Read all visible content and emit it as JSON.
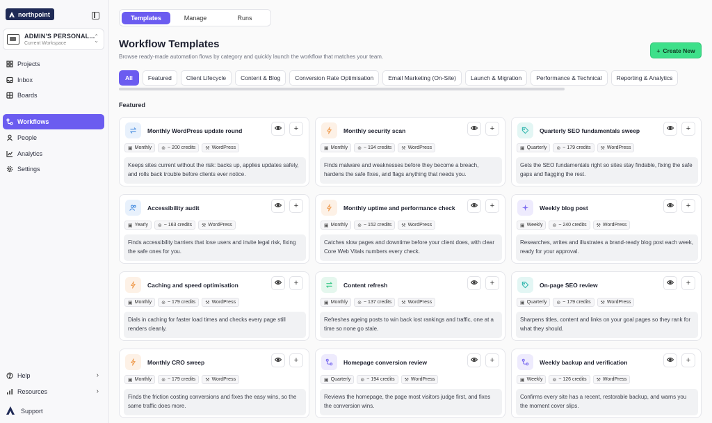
{
  "brand": {
    "logo_text": "northpoint"
  },
  "workspace": {
    "name": "ADMIN'S PERSONAL...",
    "subtitle": "Current Workspace"
  },
  "nav": {
    "projects": "Projects",
    "inbox": "Inbox",
    "boards": "Boards",
    "workflows": "Workflows",
    "people": "People",
    "analytics": "Analytics",
    "settings": "Settings",
    "help": "Help",
    "resources": "Resources",
    "support": "Support"
  },
  "tabs": {
    "templates": "Templates",
    "manage": "Manage",
    "runs": "Runs"
  },
  "header": {
    "title": "Workflow Templates",
    "subtitle": "Browse ready-made automation flows by category and quickly launch the workflow that matches your team.",
    "create_label": "Create New"
  },
  "filters": [
    "All",
    "Featured",
    "Client Lifecycle",
    "Content & Blog",
    "Conversion Rate Optimisation",
    "Email Marketing (On-Site)",
    "Launch & Migration",
    "Performance & Technical",
    "Reporting & Analytics"
  ],
  "section_title": "Featured",
  "colors": {
    "accent": "#6b5cf0",
    "create": "#3ee08a",
    "blue": "#4a8fe0",
    "orange": "#f0a35c",
    "green": "#3cc98a",
    "teal": "#35b8b0",
    "purple": "#7b6cf0"
  },
  "cards": [
    {
      "title": "Monthly WordPress update round",
      "freq": "Monthly",
      "credits": "~ 200 credits",
      "platform": "WordPress",
      "desc": "Keeps sites current without the risk: backs up, applies updates safely, and rolls back trouble before clients ever notice.",
      "icon": "sync-icon"
    },
    {
      "title": "Monthly security scan",
      "freq": "Monthly",
      "credits": "~ 194 credits",
      "platform": "WordPress",
      "desc": "Finds malware and weaknesses before they become a breach, hardens the safe fixes, and flags anything that needs you.",
      "icon": "bolt-icon"
    },
    {
      "title": "Quarterly SEO fundamentals sweep",
      "freq": "Quarterly",
      "credits": "~ 179 credits",
      "platform": "WordPress",
      "desc": "Gets the SEO fundamentals right so sites stay findable, fixing the safe gaps and flagging the rest.",
      "icon": "tag-icon"
    },
    {
      "title": "Accessibility audit",
      "freq": "Yearly",
      "credits": "~ 163 credits",
      "platform": "WordPress",
      "desc": "Finds accessibility barriers that lose users and invite legal risk, fixing the safe ones for you.",
      "icon": "users-icon"
    },
    {
      "title": "Monthly uptime and performance check",
      "freq": "Monthly",
      "credits": "~ 152 credits",
      "platform": "WordPress",
      "desc": "Catches slow pages and downtime before your client does, with clear Core Web Vitals numbers every check.",
      "icon": "bolt-icon"
    },
    {
      "title": "Weekly blog post",
      "freq": "Weekly",
      "credits": "~ 240 credits",
      "platform": "WordPress",
      "desc": "Researches, writes and illustrates a brand-ready blog post each week, ready for your approval.",
      "icon": "sparkle-icon"
    },
    {
      "title": "Caching and speed optimisation",
      "freq": "Monthly",
      "credits": "~ 179 credits",
      "platform": "WordPress",
      "desc": "Dials in caching for faster load times and checks every page still renders cleanly.",
      "icon": "bolt-icon"
    },
    {
      "title": "Content refresh",
      "freq": "Monthly",
      "credits": "~ 137 credits",
      "platform": "WordPress",
      "desc": "Refreshes ageing posts to win back lost rankings and traffic, one at a time so none go stale.",
      "icon": "refresh-icon"
    },
    {
      "title": "On-page SEO review",
      "freq": "Quarterly",
      "credits": "~ 179 credits",
      "platform": "WordPress",
      "desc": "Sharpens titles, content and links on your goal pages so they rank for what they should.",
      "icon": "tag-icon"
    },
    {
      "title": "Monthly CRO sweep",
      "freq": "Monthly",
      "credits": "~ 179 credits",
      "platform": "WordPress",
      "desc": "Finds the friction costing conversions and fixes the easy wins, so the same traffic does more.",
      "icon": "bolt-icon"
    },
    {
      "title": "Homepage conversion review",
      "freq": "Quarterly",
      "credits": "~ 194 credits",
      "platform": "WordPress",
      "desc": "Reviews the homepage, the page most visitors judge first, and fixes the conversion wins.",
      "icon": "workflow-icon"
    },
    {
      "title": "Weekly backup and verification",
      "freq": "Weekly",
      "credits": "~ 126 credits",
      "platform": "WordPress",
      "desc": "Confirms every site has a recent, restorable backup, and warns you the moment cover slips.",
      "icon": "workflow-icon"
    }
  ]
}
